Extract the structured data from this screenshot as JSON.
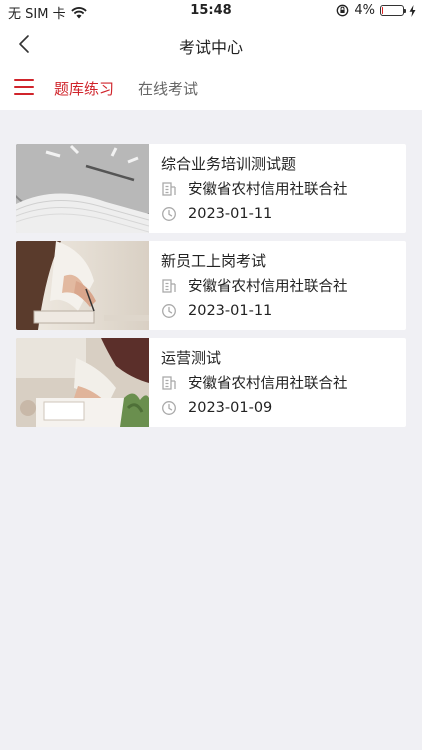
{
  "status_bar": {
    "carrier": "无 SIM 卡",
    "time": "15:48",
    "battery_percent": "4%",
    "battery_level": 0.04,
    "battery_color": "#e02020"
  },
  "nav": {
    "title": "考试中心"
  },
  "tabs": [
    {
      "label": "题库练习",
      "active": true
    },
    {
      "label": "在线考试",
      "active": false
    }
  ],
  "accent_color": "#d0242b",
  "exams": [
    {
      "title": "综合业务培训测试题",
      "org": "安徽省农村信用社联合社",
      "date": "2023-01-11",
      "image": "clock-and-papers"
    },
    {
      "title": "新员工上岗考试",
      "org": "安徽省农村信用社联合社",
      "date": "2023-01-11",
      "image": "person-writing-notebook"
    },
    {
      "title": "运营测试",
      "org": "安徽省农村信用社联合社",
      "date": "2023-01-09",
      "image": "person-writing-at-desk"
    }
  ]
}
